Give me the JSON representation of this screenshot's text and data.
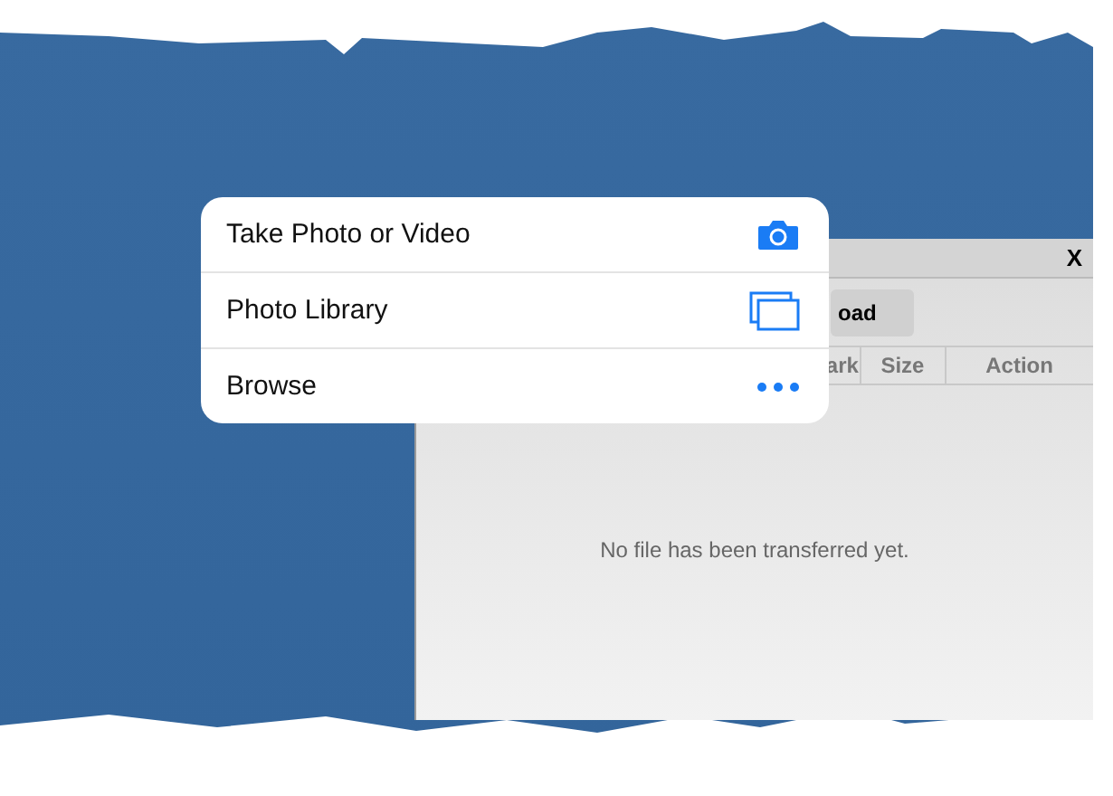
{
  "dialog": {
    "close": "X",
    "button": "oad",
    "columns": [
      "ark",
      "Size",
      "Action"
    ],
    "empty_message": "No file has been transferred yet."
  },
  "menu": [
    {
      "label": "Take Photo or Video",
      "kind": "camera"
    },
    {
      "label": "Photo Library",
      "kind": "library"
    },
    {
      "label": "Browse",
      "kind": "more"
    }
  ]
}
